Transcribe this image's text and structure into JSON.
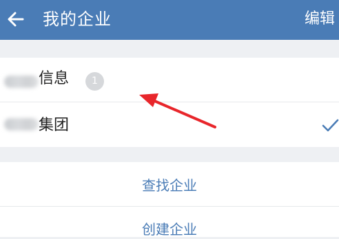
{
  "header": {
    "back_icon": "arrow-left-icon",
    "title": "我的企业",
    "edit_label": "编辑"
  },
  "companies": [
    {
      "name": "信息",
      "badge": "1",
      "selected": false
    },
    {
      "name": "集团",
      "badge": "",
      "selected": true
    }
  ],
  "actions": {
    "find_label": "查找企业",
    "create_label": "创建企业"
  },
  "colors": {
    "header_bg": "#4a7cb6",
    "accent": "#4a7cb6",
    "arrow": "#e8262b",
    "badge_bg": "#d6d8db",
    "check": "#4a7cb6"
  }
}
